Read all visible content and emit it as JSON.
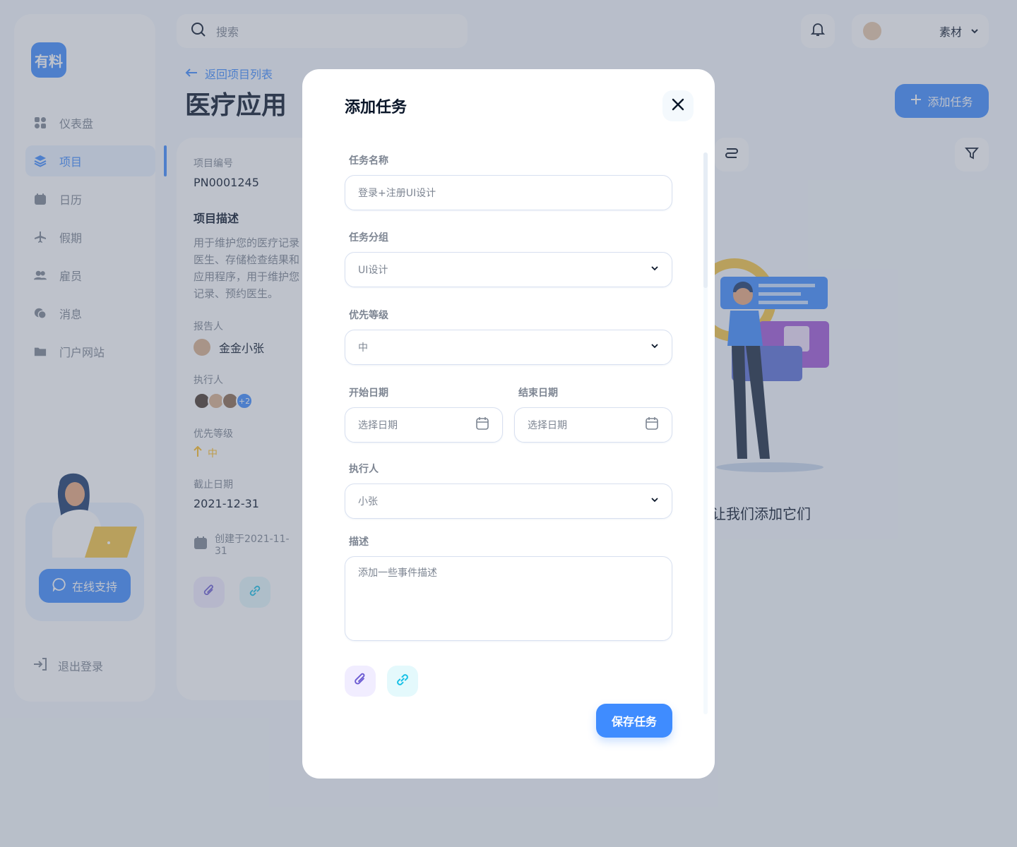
{
  "app": {
    "logo_text": "有料",
    "search_placeholder": "搜索",
    "profile_name": "素材"
  },
  "sidebar": {
    "items": [
      {
        "label": "仪表盘",
        "icon": "dashboard-icon"
      },
      {
        "label": "项目",
        "icon": "layers-icon",
        "active": true
      },
      {
        "label": "日历",
        "icon": "calendar-icon"
      },
      {
        "label": "假期",
        "icon": "plane-icon"
      },
      {
        "label": "雇员",
        "icon": "users-icon"
      },
      {
        "label": "消息",
        "icon": "chat-icon"
      },
      {
        "label": "门户网站",
        "icon": "folder-icon"
      }
    ],
    "support_label": "在线支持",
    "logout_label": "退出登录"
  },
  "header": {
    "back_label": "返回项目列表",
    "title": "医疗应用",
    "add_task_label": "添加任务"
  },
  "project": {
    "number_label": "项目编号",
    "number": "PN0001245",
    "desc_title": "项目描述",
    "desc_lines": [
      "用于维护您的医疗记录",
      "医生、存储检查结果和",
      "应用程序，用于维护您",
      "记录、预约医生。"
    ],
    "reporter_label": "报告人",
    "reporter": "金金小张",
    "assignee_label": "执行人",
    "assignee_more": "+2",
    "priority_label": "优先等级",
    "priority_value": "中",
    "deadline_label": "截止日期",
    "deadline": "2021-12-31",
    "created": "创建于2021-11-31"
  },
  "empty_state": {
    "text": "让我们添加它们"
  },
  "modal": {
    "title": "添加任务",
    "task_name_label": "任务名称",
    "task_name_value": "登录+注册UI设计",
    "group_label": "任务分组",
    "group_value": "UI设计",
    "priority_label": "优先等级",
    "priority_value": "中",
    "start_label": "开始日期",
    "start_placeholder": "选择日期",
    "end_label": "结束日期",
    "end_placeholder": "选择日期",
    "assignee_label": "执行人",
    "assignee_value": "小张",
    "desc_label": "描述",
    "desc_placeholder": "添加一些事件描述",
    "save_label": "保存任务"
  },
  "colors": {
    "primary": "#3F8CFF",
    "priority": "#FFBD21",
    "attach_purple": "#6D5DD3",
    "link_cyan": "#15C0E6"
  }
}
